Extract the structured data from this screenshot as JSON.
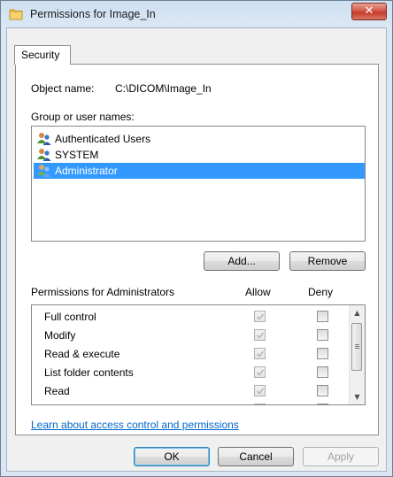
{
  "window": {
    "title": "Permissions for Image_In",
    "close_label": "✕"
  },
  "tabs": [
    {
      "label": "Security"
    }
  ],
  "object": {
    "label": "Object name:",
    "value": "C:\\DICOM\\Image_In"
  },
  "groups": {
    "label": "Group or user names:",
    "items": [
      {
        "label": "Authenticated Users",
        "selected": false
      },
      {
        "label": "SYSTEM",
        "selected": false
      },
      {
        "label": "Administrator",
        "selected": true
      }
    ],
    "add_label": "Add...",
    "remove_label": "Remove"
  },
  "permissions": {
    "header": "Permissions for Administrators",
    "allow_label": "Allow",
    "deny_label": "Deny",
    "rows": [
      {
        "name": "Full control",
        "allow": true,
        "deny": false
      },
      {
        "name": "Modify",
        "allow": true,
        "deny": false
      },
      {
        "name": "Read & execute",
        "allow": true,
        "deny": false
      },
      {
        "name": "List folder contents",
        "allow": true,
        "deny": false
      },
      {
        "name": "Read",
        "allow": true,
        "deny": false
      }
    ]
  },
  "link_text": "Learn about access control and permissions",
  "footer": {
    "ok_label": "OK",
    "cancel_label": "Cancel",
    "apply_label": "Apply"
  },
  "colors": {
    "selection": "#3399ff",
    "link": "#0066cc",
    "close_button": "#c43b2a"
  },
  "icons": {
    "window": "folder-icon",
    "users": "users-icon",
    "scroll_up": "scroll-up-arrow-icon",
    "scroll_down": "scroll-down-arrow-icon"
  }
}
